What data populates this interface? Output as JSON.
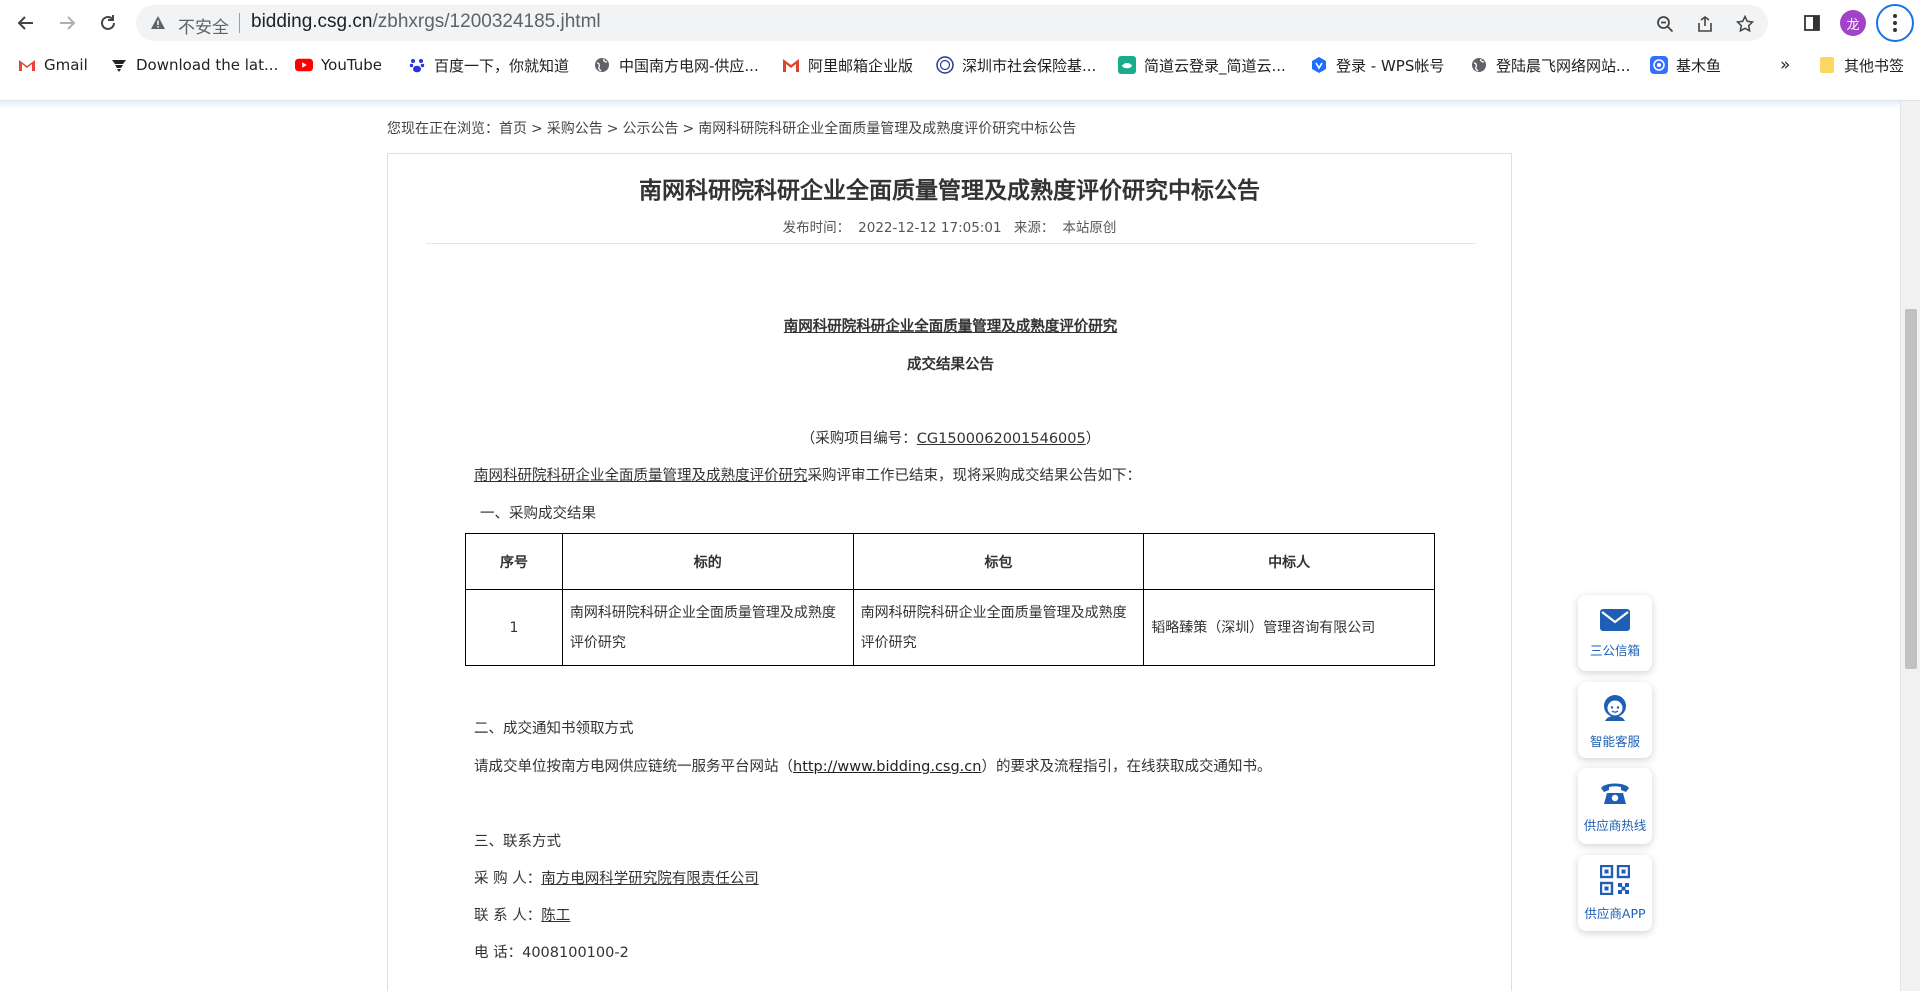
{
  "browser": {
    "insecure_label": "不安全",
    "url_host": "bidding.csg.cn",
    "url_path": "/zbhxrgs/1200324185.jhtml",
    "avatar_text": "龙",
    "bookmarks": [
      {
        "label": "Gmail",
        "icon": "gmail-icon"
      },
      {
        "label": "Download the lat...",
        "icon": "download-icon"
      },
      {
        "label": "YouTube",
        "icon": "youtube-icon"
      },
      {
        "label": "百度一下，你就知道",
        "icon": "baidu-icon"
      },
      {
        "label": "中国南方电网-供应...",
        "icon": "globe-icon"
      },
      {
        "label": "阿里邮箱企业版",
        "icon": "aliyun-mail-icon"
      },
      {
        "label": "深圳市社会保险基...",
        "icon": "seal-icon"
      },
      {
        "label": "简道云登录_简道云...",
        "icon": "jiandaoyun-icon"
      },
      {
        "label": "登录 - WPS帐号",
        "icon": "wps-icon"
      },
      {
        "label": "登陆晨飞网络网站...",
        "icon": "globe-icon"
      },
      {
        "label": "基木鱼",
        "icon": "jimuyu-icon"
      }
    ],
    "overflow_label": "»",
    "other_bookmarks": "其他书签"
  },
  "page": {
    "breadcrumb": {
      "prefix": "您现在正在浏览：",
      "items": [
        "首页",
        "采购公告",
        "公示公告",
        "南网科研院科研企业全面质量管理及成熟度评价研究中标公告"
      ],
      "sep": ">"
    },
    "title": "南网科研院科研企业全面质量管理及成熟度评价研究中标公告",
    "meta": {
      "time_label": "发布时间：",
      "time_value": "2022-12-12 17:05:01",
      "source_label": "来源：",
      "source_value": "本站原创"
    },
    "notice": {
      "project_name": "南网科研院科研企业全面质量管理及成熟度评价研究",
      "heading": "成交结果公告",
      "project_no_prefix": "（采购项目编号：",
      "project_no": "CG1500062001546005",
      "project_no_suffix": "）",
      "intro_link": "南网科研院科研企业全面质量管理及成熟度评价研究",
      "intro_rest": "采购评审工作已结束，现将采购成交结果公告如下：",
      "section1": "一、采购成交结果",
      "table": {
        "headers": [
          "序号",
          "标的",
          "标包",
          "中标人"
        ],
        "rows": [
          [
            "1",
            "南网科研院科研企业全面质量管理及成熟度评价研究",
            "南网科研院科研企业全面质量管理及成熟度评价研究",
            "韬略臻策（深圳）管理咨询有限公司"
          ]
        ]
      },
      "section2": "二、成交通知书领取方式",
      "section2_text_a": "请成交单位按南方电网供应链统一服务平台网站（",
      "section2_link": "http://www.bidding.csg.cn",
      "section2_text_b": "）的要求及流程指引，在线获取成交通知书。",
      "section3": "三、联系方式",
      "buyer_label": "采 购 人：",
      "buyer_value": "南方电网科学研究院有限责任公司",
      "contact_label": "联 系 人：",
      "contact_value": "陈工",
      "phone_label": "电 话：",
      "phone_value": "4008100100-2"
    }
  },
  "side_buttons": [
    {
      "label": "三公信箱",
      "icon": "mail-icon"
    },
    {
      "label": "智能客服",
      "icon": "customer-service-icon"
    },
    {
      "label": "供应商热线",
      "icon": "phone-icon"
    },
    {
      "label": "供应商APP",
      "icon": "qr-code-icon"
    }
  ],
  "colors": {
    "accent": "#1d5fb4",
    "avatar": "#a142c8",
    "focus_ring": "#1a73e8"
  }
}
